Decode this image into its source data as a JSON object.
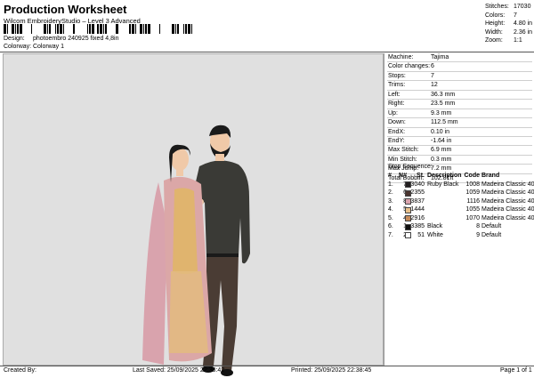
{
  "header": {
    "title": "Production Worksheet",
    "subtitle": "Wilcom EmbroideryStudio – Level 3 Advanced",
    "design_label": "Design:",
    "design_value": "photoembro 240925 fixed 4,8in",
    "colorway_label": "Colorway:",
    "colorway_value": "Colorway 1"
  },
  "stats": [
    {
      "label": "Stitches:",
      "value": "17030"
    },
    {
      "label": "Colors:",
      "value": "7"
    },
    {
      "label": "Height:",
      "value": "4.80 in"
    },
    {
      "label": "Width:",
      "value": "2.36 in"
    },
    {
      "label": "Zoom:",
      "value": "1:1"
    }
  ],
  "machine": [
    {
      "label": "Machine:",
      "value": "Tajima"
    },
    {
      "label": "Color changes:",
      "value": "6"
    },
    {
      "label": "Stops:",
      "value": "7"
    },
    {
      "label": "Trims:",
      "value": "12"
    },
    {
      "label": "Left:",
      "value": "36.3 mm"
    },
    {
      "label": "Right:",
      "value": "23.5 mm"
    },
    {
      "label": "Up:",
      "value": "9.3 mm"
    },
    {
      "label": "Down:",
      "value": "112.5 mm"
    },
    {
      "label": "EndX:",
      "value": "0.10 in"
    },
    {
      "label": "EndY:",
      "value": "-1.64 in"
    },
    {
      "label": "Max Stitch:",
      "value": "6.9 mm"
    },
    {
      "label": "Min Stitch:",
      "value": "0.3 mm"
    },
    {
      "label": "Max Jump:",
      "value": "7.2 mm"
    },
    {
      "label": "Total Bobbin:",
      "value": "102.81ft"
    }
  ],
  "stop_sequence": {
    "title": "Stop Sequence:",
    "headers": {
      "index": "#",
      "n": "N#",
      "st": "St.",
      "desc": "Description",
      "code": "Code",
      "brand": "Brand"
    },
    "rows": [
      {
        "index": "1.",
        "n": "7",
        "swatch": "#231f20",
        "st": "3040",
        "desc": "Ruby Black",
        "code": "1008",
        "brand": "Madeira Classic 40"
      },
      {
        "index": "2.",
        "n": "6",
        "swatch": "#4a3530",
        "st": "2355",
        "desc": "",
        "code": "1059",
        "brand": "Madeira Classic 40"
      },
      {
        "index": "3.",
        "n": "8",
        "swatch": "#d9a3ad",
        "st": "3837",
        "desc": "",
        "code": "1116",
        "brand": "Madeira Classic 40"
      },
      {
        "index": "4.",
        "n": "5",
        "swatch": "#e8c08a",
        "st": "1444",
        "desc": "",
        "code": "1055",
        "brand": "Madeira Classic 40"
      },
      {
        "index": "5.",
        "n": "4",
        "swatch": "#c58a5a",
        "st": "2916",
        "desc": "",
        "code": "1070",
        "brand": "Madeira Classic 40"
      },
      {
        "index": "6.",
        "n": "1",
        "swatch": "#111111",
        "st": "3385",
        "desc": "Black",
        "code": "8",
        "brand": "Default"
      },
      {
        "index": "7.",
        "n": "2",
        "swatch": "#ffffff",
        "st": "51",
        "desc": "White",
        "code": "9",
        "brand": "Default"
      }
    ]
  },
  "footer": {
    "created_by": "Created By:",
    "last_saved": "Last Saved: 25/09/2025 22:38:42",
    "printed": "Printed: 25/09/2025 22:38:45",
    "page": "Page 1 of 1"
  },
  "colors": {
    "design_bg": "#e0e0e0",
    "shirt": "#3a3a36",
    "pants": "#4a3c34",
    "skin": "#f0c9a8",
    "dupatta": "#d9a3ad",
    "gold": "#e0b46e"
  }
}
